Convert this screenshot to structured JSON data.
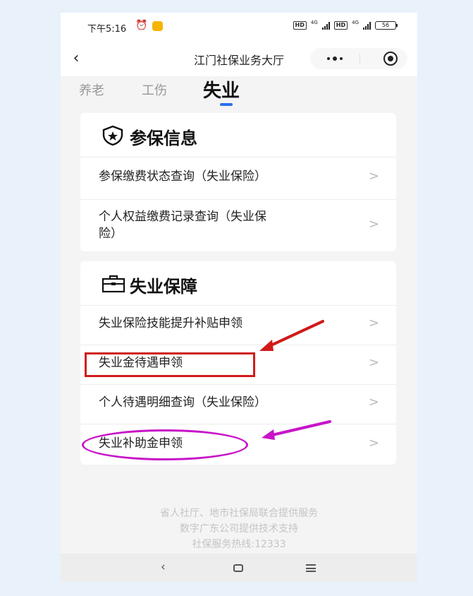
{
  "status_bar": {
    "time": "下午5:16",
    "hd1": "HD",
    "net1": "4G",
    "hd2": "HD",
    "net2": "4G",
    "battery": "56"
  },
  "nav": {
    "title": "江门社保业务大厅"
  },
  "tabs": [
    {
      "label": "养老",
      "active": false
    },
    {
      "label": "工伤",
      "active": false
    },
    {
      "label": "失业",
      "active": true
    }
  ],
  "sections": [
    {
      "title": "参保信息",
      "icon": "shield-icon",
      "items": [
        {
          "label": "参保缴费状态查询（失业保险）"
        },
        {
          "label_line1": "个人权益缴费记录查询（失业保",
          "label_line2": "险）"
        }
      ]
    },
    {
      "title": "失业保障",
      "icon": "briefcase-icon",
      "items": [
        {
          "label": "失业保险技能提升补贴申领"
        },
        {
          "label": "失业金待遇申领"
        },
        {
          "label": "个人待遇明细查询（失业保险）"
        },
        {
          "label": "失业补助金申领"
        }
      ]
    }
  ],
  "chevron": ">",
  "footer": [
    "省人社厅、地市社保局联合提供服务",
    "数字广东公司提供技术支持",
    "社保服务热线:12333"
  ],
  "colors": {
    "accent": "#2a6ef0",
    "annotation_red": "#d11a1a",
    "annotation_magenta": "#c814c8"
  }
}
